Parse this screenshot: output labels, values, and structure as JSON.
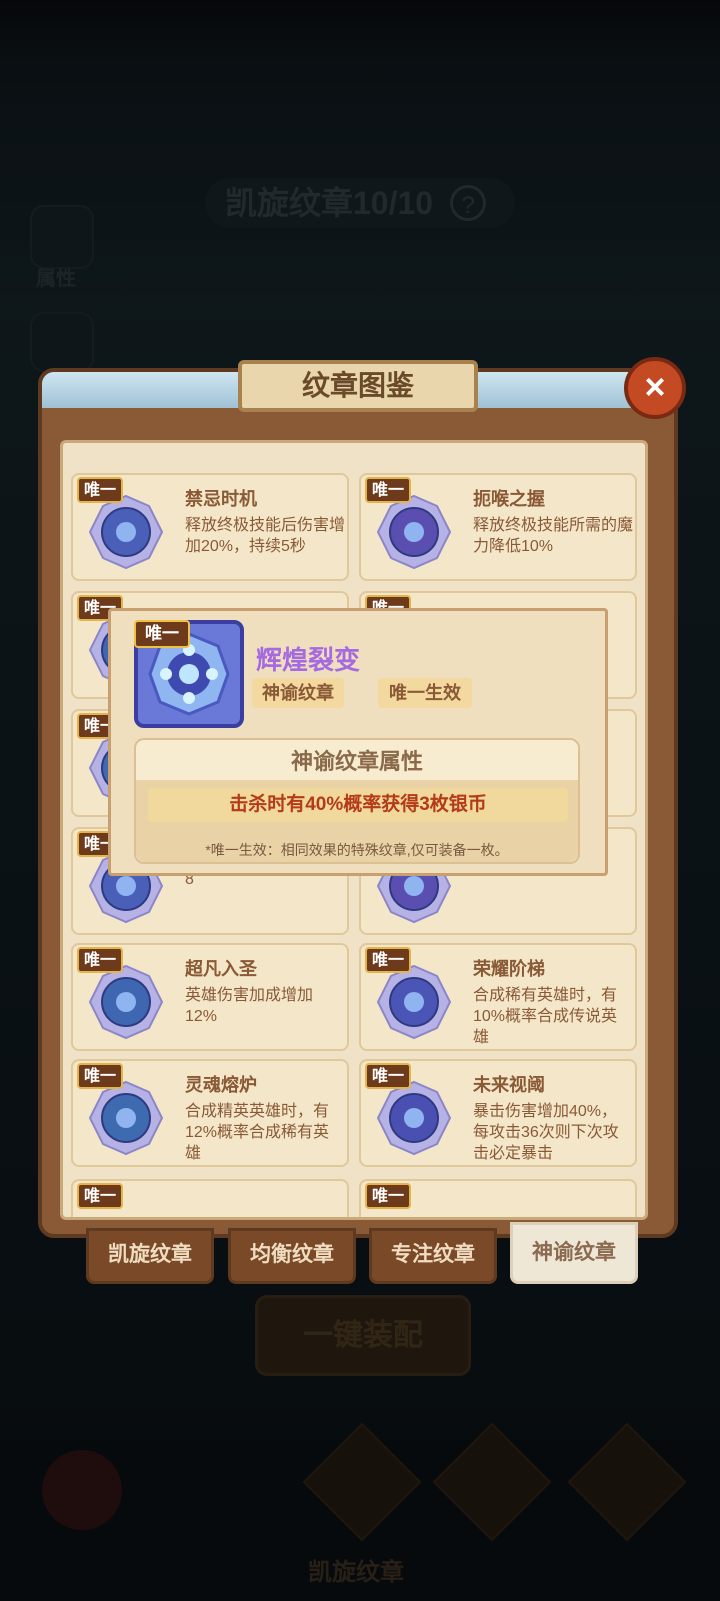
{
  "background": {
    "title": "凯旋纹章10/10",
    "help_icon": "?",
    "side_label": "属性",
    "equip_button": "一键装配",
    "bottom_label": "凯旋纹章"
  },
  "panel": {
    "title": "纹章图鉴",
    "close_icon": "×",
    "badge": "唯一",
    "cards": [
      {
        "title": "禁忌时机",
        "desc": "释放终极技能后伤害增加20%，持续5秒"
      },
      {
        "title": "扼喉之握",
        "desc": "释放终极技能所需的魔力降低10%"
      },
      {
        "title": "",
        "desc": ""
      },
      {
        "title": "",
        "desc": ""
      },
      {
        "title": "",
        "desc": ""
      },
      {
        "title": "",
        "desc": ""
      },
      {
        "title": "",
        "desc": "8"
      },
      {
        "title": "",
        "desc": ""
      },
      {
        "title": "超凡入圣",
        "desc": "英雄伤害加成增加12%"
      },
      {
        "title": "荣耀阶梯",
        "desc": "合成稀有英雄时，有10%概率合成传说英雄"
      },
      {
        "title": "灵魂熔炉",
        "desc": "合成精英英雄时，有12%概率合成稀有英雄"
      },
      {
        "title": "未来视阈",
        "desc": "暴击伤害增加40%，每攻击36次则下次攻击必定暴击"
      }
    ]
  },
  "tabs": [
    {
      "label": "凯旋纹章"
    },
    {
      "label": "均衡纹章"
    },
    {
      "label": "专注纹章"
    },
    {
      "label": "神谕纹章"
    }
  ],
  "popup": {
    "badge": "唯一",
    "name": "辉煌裂变",
    "tag_type": "神谕纹章",
    "tag_effect": "唯一生效",
    "attr_title": "神谕纹章属性",
    "attr_value": "击杀时有40%概率获得3枚银币",
    "note": "*唯一生效：相同效果的特殊纹章,仅可装备一枚。"
  },
  "colors": {
    "panel_brown": "#8a5a36",
    "card_bg": "#f3e6c9",
    "popup_name": "#a66ae0",
    "attr_value": "#b43a18",
    "close_red": "#c44a24"
  }
}
